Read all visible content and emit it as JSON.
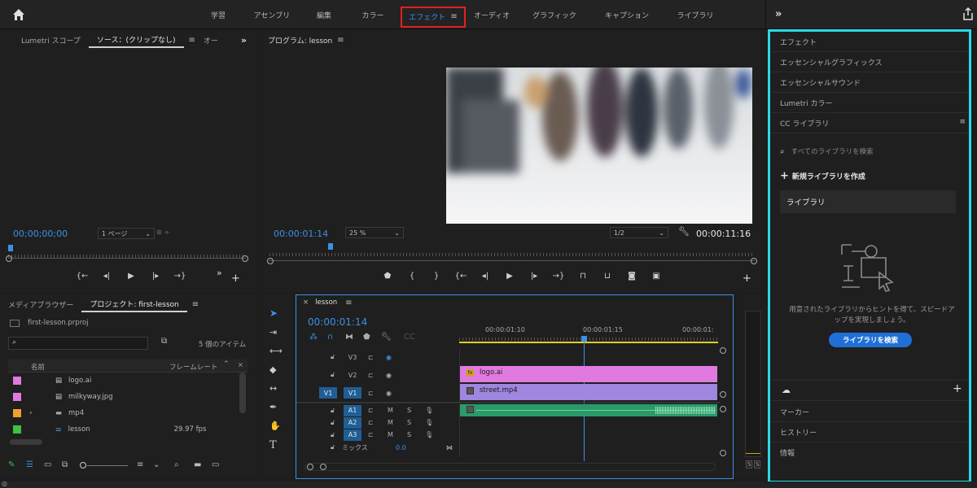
{
  "workspaces": {
    "tabs": [
      "学習",
      "アセンブリ",
      "編集",
      "カラー",
      "エフェクト",
      "オーディオ",
      "グラフィック",
      "キャプション",
      "ライブラリ"
    ],
    "active": "エフェクト",
    "expand_glyph": "»"
  },
  "source_panel": {
    "tabs": [
      "Lumetri スコープ",
      "ソース：(クリップなし)",
      "オー"
    ],
    "timecode": "00;00;00;00",
    "page_dropdown": "1 ページ"
  },
  "program_panel": {
    "title": "プログラム: lesson",
    "timecode": "00:00:01:14",
    "zoom": "25 %",
    "resolution": "1/2",
    "duration": "00:00:11:16"
  },
  "project_panel": {
    "tabs": [
      "メディアブラウザー",
      "プロジェクト: first-lesson"
    ],
    "file_name": "first-lesson.prproj",
    "item_count": "5 個のアイテム",
    "col_name": "名前",
    "col_framerate": "フレームレート",
    "items": [
      {
        "name": "logo.ai",
        "color": "#e07ae0",
        "fps": ""
      },
      {
        "name": "milkyway.jpg",
        "color": "#e07ae0",
        "fps": ""
      },
      {
        "name": "mp4",
        "color": "#f0a030",
        "fps": "",
        "folder": true
      },
      {
        "name": "lesson",
        "color": "#40c040",
        "fps": "29.97 fps"
      }
    ]
  },
  "timeline": {
    "title": "lesson",
    "timecode": "00:00:01:14",
    "ruler_times": [
      "00:00:01:10",
      "00:00:01:15",
      "00:00:01:"
    ],
    "video_tracks": [
      "V3",
      "V2",
      "V1"
    ],
    "audio_tracks": [
      "A1",
      "A2",
      "A3"
    ],
    "v1_source": "V1",
    "a1_source": "A1",
    "mix_label": "ミックス",
    "mix_value": "0.0",
    "clip_logo": "logo.ai",
    "clip_street": "street.mp4",
    "logo_color": "#e07ae0",
    "street_color": "#9f86de",
    "audio_color": "#2a9a6a"
  },
  "right_panel": {
    "items_top": [
      "エフェクト",
      "エッセンシャルグラフィックス",
      "エッセンシャルサウンド",
      "Lumetri カラー",
      "CC ライブラリ"
    ],
    "search_placeholder": "すべてのライブラリを検索",
    "new_library": "新規ライブラリを作成",
    "library_select": "ライブラリ",
    "hint_text": "用意されたライブラリからヒントを得て、スピードアップを実現しましょう。",
    "search_button": "ライブラリを検索",
    "items_bottom": [
      "マーカー",
      "ヒストリー",
      "情報"
    ],
    "highlight_color": "#29d9e8"
  },
  "audio_meter": {
    "labels": [
      "S",
      "S"
    ]
  },
  "highlight_tab_color": "#e02020",
  "accent_color": "#3c8fe6"
}
